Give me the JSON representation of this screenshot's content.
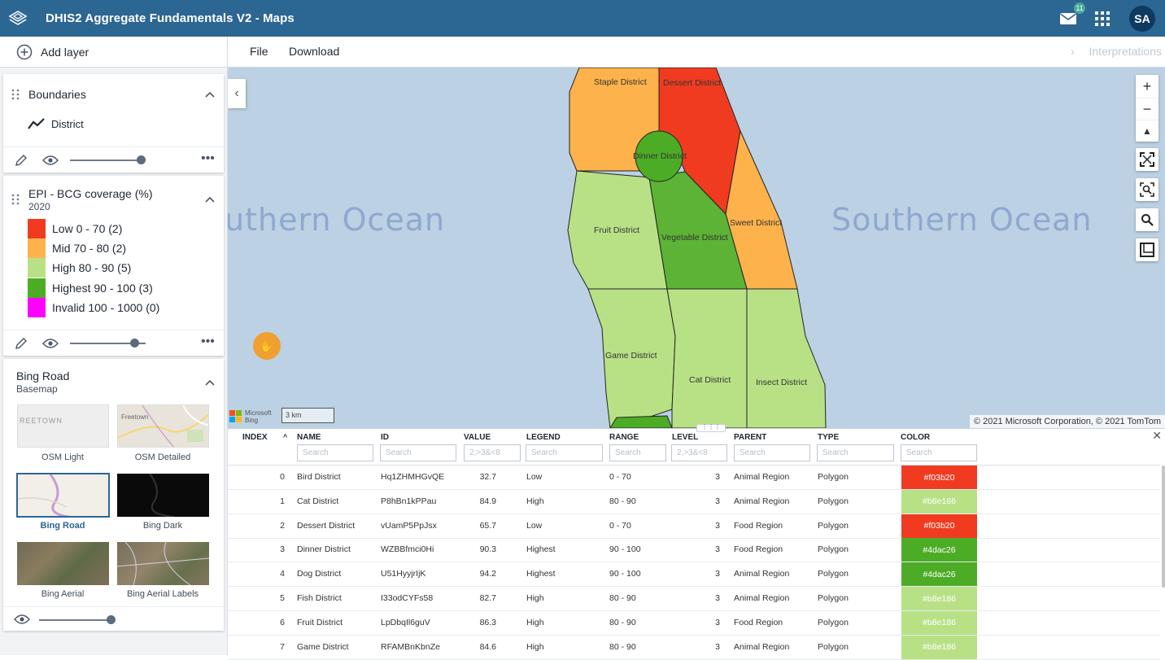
{
  "header": {
    "app_title": "DHIS2 Aggregate Fundamentals V2 - Maps",
    "mail_badge": "11",
    "avatar_initials": "SA",
    "bg_color": "#2c6693"
  },
  "toolbar": {
    "add_layer": "Add layer",
    "file": "File",
    "download": "Download",
    "interpretations": "Interpretations"
  },
  "layers": {
    "boundaries": {
      "title": "Boundaries",
      "item": "District"
    },
    "thematic": {
      "title": "EPI - BCG coverage (%)",
      "period": "2020",
      "legend": [
        {
          "label": "Low 0 - 70 (2)",
          "color": "#f03b20"
        },
        {
          "label": "Mid 70 - 80 (2)",
          "color": "#feb24c"
        },
        {
          "label": "High 80 - 90 (5)",
          "color": "#b8e186"
        },
        {
          "label": "Highest 90 - 100 (3)",
          "color": "#4dac26"
        },
        {
          "label": "Invalid 100 - 1000 (0)",
          "color": "#ff00ff"
        }
      ]
    },
    "basemap": {
      "title": "Bing Road",
      "subtitle": "Basemap",
      "options": [
        {
          "label": "OSM Light",
          "thumb_text": "REETOWN"
        },
        {
          "label": "OSM Detailed",
          "thumb_text": "Freetown"
        },
        {
          "label": "Bing Road",
          "selected": true
        },
        {
          "label": "Bing Dark"
        },
        {
          "label": "Bing Aerial"
        },
        {
          "label": "Bing Aerial Labels"
        }
      ]
    }
  },
  "map": {
    "ocean_left": "uthern Ocean",
    "ocean_right": "Southern Ocean",
    "attribution": "© 2021 Microsoft Corporation, © 2021 TomTom",
    "scale": "3 km",
    "ms_logo_line1": "Microsoft",
    "ms_logo_line2": "Bing",
    "districts": [
      {
        "name": "Staple District",
        "color": "#feb24c"
      },
      {
        "name": "Dessert District",
        "color": "#f03b20"
      },
      {
        "name": "Dinner District",
        "color": "#4dac26"
      },
      {
        "name": "Fruit District",
        "color": "#b8e186"
      },
      {
        "name": "Vegetable District",
        "color": "#5cb335"
      },
      {
        "name": "Sweet District",
        "color": "#feb24c"
      },
      {
        "name": "Game District",
        "color": "#b8e186"
      },
      {
        "name": "Cat District",
        "color": "#b8e186"
      },
      {
        "name": "Insect District",
        "color": "#b8e186"
      }
    ]
  },
  "table": {
    "headers": [
      "INDEX",
      "NAME",
      "ID",
      "VALUE",
      "LEGEND",
      "RANGE",
      "LEVEL",
      "PARENT",
      "TYPE",
      "COLOR"
    ],
    "sort_indicator": "^",
    "filters": {
      "name": "Search",
      "id": "Search",
      "value": "2,>3&<8",
      "legend": "Search",
      "range": "Search",
      "level": "2,>3&<8",
      "parent": "Search",
      "type": "Search",
      "color": "Search"
    },
    "rows": [
      {
        "index": "0",
        "name": "Bird District",
        "id": "Hq1ZHMHGvQE",
        "value": "32.7",
        "legend": "Low",
        "range": "0 - 70",
        "level": "3",
        "parent": "Animal Region",
        "type": "Polygon",
        "color": "#f03b20"
      },
      {
        "index": "1",
        "name": "Cat District",
        "id": "P8hBn1kPPau",
        "value": "84.9",
        "legend": "High",
        "range": "80 - 90",
        "level": "3",
        "parent": "Animal Region",
        "type": "Polygon",
        "color": "#b8e186"
      },
      {
        "index": "2",
        "name": "Dessert District",
        "id": "vUamP5PpJsx",
        "value": "65.7",
        "legend": "Low",
        "range": "0 - 70",
        "level": "3",
        "parent": "Food Region",
        "type": "Polygon",
        "color": "#f03b20"
      },
      {
        "index": "3",
        "name": "Dinner District",
        "id": "WZBBfmci0Hi",
        "value": "90.3",
        "legend": "Highest",
        "range": "90 - 100",
        "level": "3",
        "parent": "Food Region",
        "type": "Polygon",
        "color": "#4dac26"
      },
      {
        "index": "4",
        "name": "Dog District",
        "id": "U51HyyjrIjK",
        "value": "94.2",
        "legend": "Highest",
        "range": "90 - 100",
        "level": "3",
        "parent": "Animal Region",
        "type": "Polygon",
        "color": "#4dac26"
      },
      {
        "index": "5",
        "name": "Fish District",
        "id": "I33odCYFs58",
        "value": "82.7",
        "legend": "High",
        "range": "80 - 90",
        "level": "3",
        "parent": "Animal Region",
        "type": "Polygon",
        "color": "#b8e186"
      },
      {
        "index": "6",
        "name": "Fruit District",
        "id": "LpDbqIl6guV",
        "value": "86.3",
        "legend": "High",
        "range": "80 - 90",
        "level": "3",
        "parent": "Food Region",
        "type": "Polygon",
        "color": "#b8e186"
      },
      {
        "index": "7",
        "name": "Game District",
        "id": "RFAMBnKbnZe",
        "value": "84.6",
        "legend": "High",
        "range": "80 - 90",
        "level": "3",
        "parent": "Animal Region",
        "type": "Polygon",
        "color": "#b8e186"
      }
    ]
  }
}
